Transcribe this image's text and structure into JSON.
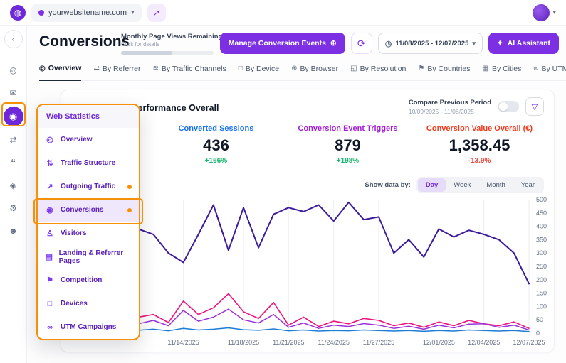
{
  "topbar": {
    "site_name": "yourwebsitename.com"
  },
  "sidebar": {
    "icons": [
      {
        "name": "collapse",
        "glyph": "‹"
      },
      {
        "name": "dashboard",
        "glyph": "◎"
      },
      {
        "name": "campaigns",
        "glyph": "✉"
      },
      {
        "name": "web-statistics",
        "glyph": "◉",
        "active": true
      },
      {
        "name": "integrations",
        "glyph": "⇄"
      },
      {
        "name": "chat",
        "glyph": "❝"
      },
      {
        "name": "security",
        "glyph": "◈"
      },
      {
        "name": "settings",
        "glyph": "⚙"
      },
      {
        "name": "users",
        "glyph": "☻"
      }
    ]
  },
  "header": {
    "title": "Conversions",
    "pageviews_label": "Monthly Page Views Remaining",
    "pageviews_link": "Click for details",
    "manage_button": "Manage Conversion Events",
    "manage_icon": "⊕",
    "refresh_icon": "⟳",
    "date_icon": "◷",
    "date_range": "11/08/2025 - 12/07/2025",
    "ai_icon": "✦",
    "ai_assistant": "AI Assistant"
  },
  "tabs": [
    {
      "label": "Overview",
      "glyph": "◎"
    },
    {
      "label": "By Referrer",
      "glyph": "⇄"
    },
    {
      "label": "By Traffic Channels",
      "glyph": "≋"
    },
    {
      "label": "By Device",
      "glyph": "□"
    },
    {
      "label": "By Browser",
      "glyph": "⊕"
    },
    {
      "label": "By Resolution",
      "glyph": "◱"
    },
    {
      "label": "By Countries",
      "glyph": "⚑"
    },
    {
      "label": "By Cities",
      "glyph": "▦"
    },
    {
      "label": "By UTM Campaign",
      "glyph": "∞"
    }
  ],
  "card": {
    "title": "Conversions Performance Overall",
    "compare_label": "Compare Previous Period",
    "compare_range": "10/09/2025 - 11/08/2025",
    "filter_icon": "▽",
    "metrics": [
      {
        "label": "Converted Sessions",
        "value": "436",
        "delta": "+166%",
        "color": "#1570ef",
        "delta_color": "#12b76a"
      },
      {
        "label": "Conversion Event Triggers",
        "value": "879",
        "delta": "+198%",
        "color": "#a21cd6",
        "delta_color": "#12b76a"
      },
      {
        "label": "Conversion Value Overall (€)",
        "value": "1,358.45",
        "delta": "-13.9%",
        "color": "#f03a1d",
        "delta_color": "#f04438"
      }
    ],
    "show_data_by": "Show data by:",
    "granularity": [
      "Day",
      "Week",
      "Month",
      "Year"
    ],
    "granularity_active": "Day"
  },
  "popup": {
    "title": "Web Statistics",
    "items": [
      {
        "label": "Overview",
        "glyph": "◎"
      },
      {
        "label": "Traffic Structure",
        "glyph": "⇅"
      },
      {
        "label": "Outgoing Traffic",
        "glyph": "↗",
        "badge": true
      },
      {
        "label": "Conversions",
        "glyph": "◉",
        "badge": true,
        "active": true
      },
      {
        "label": "Visitors",
        "glyph": "♙"
      },
      {
        "label": "Landing & Referrer Pages",
        "glyph": "▤"
      },
      {
        "label": "Competition",
        "glyph": "⚑"
      },
      {
        "label": "Devices",
        "glyph": "□"
      },
      {
        "label": "UTM Campaigns",
        "glyph": "∞"
      }
    ]
  },
  "colors": {
    "brand_purple": "#7c2fe3",
    "annotation_orange": "#f79009",
    "positive_green": "#12b76a",
    "negative_red": "#f04438"
  },
  "chart_data": {
    "type": "line",
    "title": "Conversions Performance Overall",
    "x_range": [
      "11/08/2025",
      "12/07/2025"
    ],
    "x_tick_labels": [
      "11/14/2025",
      "11/18/2025",
      "11/21/2025",
      "11/24/2025",
      "11/27/2025",
      "12/01/2025",
      "12/04/2025",
      "12/07/2025"
    ],
    "x_tick_indices": [
      6,
      10,
      13,
      16,
      19,
      23,
      26,
      29
    ],
    "ylim": [
      0,
      500
    ],
    "y_ticks": [
      0,
      50,
      100,
      150,
      200,
      250,
      300,
      350,
      400,
      450,
      500
    ],
    "grid": "vertical",
    "legend": "none",
    "series": [
      {
        "name": "dark-purple-line",
        "color": "#3b1a9e",
        "width": 2,
        "values": [
          430,
          400,
          415,
          390,
          370,
          300,
          265,
          370,
          480,
          310,
          470,
          320,
          445,
          470,
          455,
          480,
          420,
          490,
          425,
          435,
          300,
          350,
          285,
          390,
          360,
          385,
          370,
          350,
          300,
          185
        ]
      },
      {
        "name": "pink-line",
        "color": "#ed127d",
        "width": 1.6,
        "values": [
          75,
          55,
          85,
          60,
          70,
          40,
          120,
          70,
          95,
          148,
          80,
          55,
          115,
          30,
          60,
          25,
          45,
          35,
          55,
          48,
          28,
          38,
          22,
          42,
          28,
          48,
          35,
          28,
          42,
          18
        ]
      },
      {
        "name": "violet-line",
        "color": "#9b30d9",
        "width": 1.5,
        "values": [
          38,
          30,
          45,
          35,
          48,
          28,
          85,
          45,
          60,
          90,
          50,
          38,
          70,
          22,
          38,
          18,
          30,
          25,
          36,
          30,
          18,
          26,
          15,
          30,
          20,
          34,
          35,
          22,
          30,
          12
        ]
      },
      {
        "name": "blue-line",
        "color": "#1c7cd6",
        "width": 1.5,
        "values": [
          12,
          10,
          14,
          11,
          15,
          9,
          18,
          12,
          15,
          20,
          13,
          11,
          16,
          9,
          12,
          8,
          10,
          9,
          12,
          10,
          8,
          10,
          7,
          10,
          8,
          12,
          10,
          8,
          10,
          6
        ]
      }
    ]
  }
}
